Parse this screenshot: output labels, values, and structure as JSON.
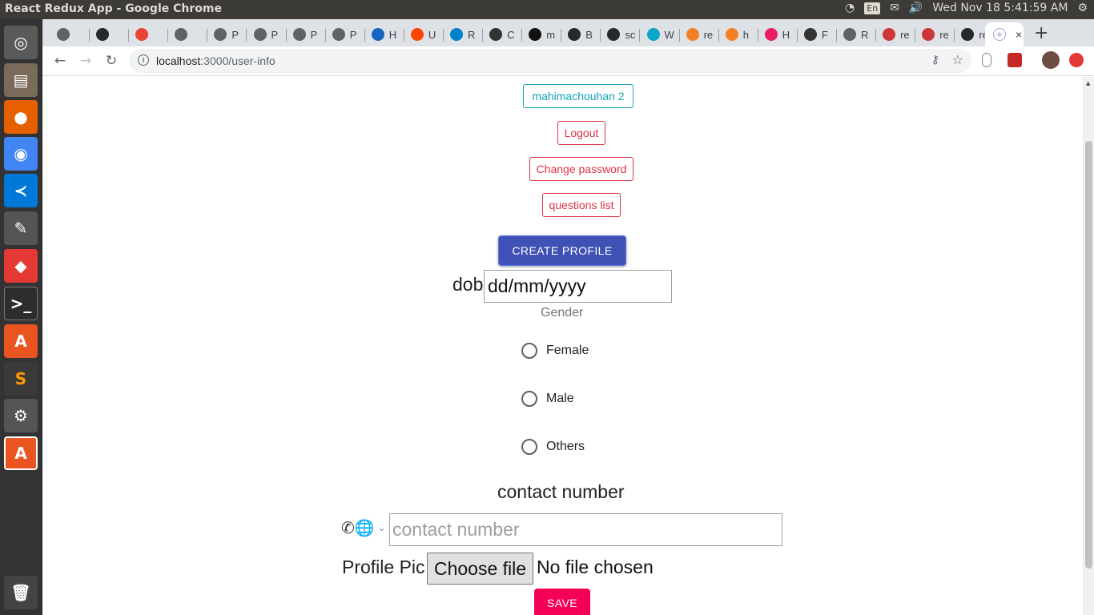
{
  "system": {
    "window_title": "React Redux App - Google Chrome",
    "keyboard": "En",
    "clock": "Wed Nov 18  5:41:59 AM"
  },
  "launcher": {
    "apps": [
      {
        "icon": "ubuntu-dash-icon",
        "color": "#5a5a5a"
      },
      {
        "icon": "files-icon",
        "color": "#7a6a5a"
      },
      {
        "icon": "firefox-icon",
        "color": "#e66000"
      },
      {
        "icon": "chrome-icon",
        "color": "#4285f4"
      },
      {
        "icon": "vscode-icon",
        "color": "#0078d7"
      },
      {
        "icon": "text-editor-icon",
        "color": "#555555"
      },
      {
        "icon": "git-client-icon",
        "color": "#e53935"
      },
      {
        "icon": "terminal-icon",
        "color": "#2d2d2d"
      },
      {
        "icon": "software-center-icon",
        "color": "#e95420"
      },
      {
        "icon": "sublime-text-icon",
        "color": "#3a3a3a"
      },
      {
        "icon": "settings-icon",
        "color": "#555555"
      },
      {
        "icon": "software-updater-icon",
        "color": "#e95420"
      }
    ],
    "trash_icon": "trash-icon"
  },
  "browser": {
    "tabs": [
      {
        "label": "",
        "color": "#5f6368",
        "icon": "globe-icon"
      },
      {
        "label": "",
        "color": "#24292e",
        "icon": "github-icon"
      },
      {
        "label": "",
        "color": "#ea4335",
        "icon": "gmail-icon"
      },
      {
        "label": "",
        "color": "#5f6368",
        "icon": "globe-icon"
      },
      {
        "label": "P",
        "color": "#5f6368",
        "icon": "globe-icon"
      },
      {
        "label": "P",
        "color": "#5f6368",
        "icon": "globe-icon"
      },
      {
        "label": "P",
        "color": "#5f6368",
        "icon": "globe-icon"
      },
      {
        "label": "P",
        "color": "#5f6368",
        "icon": "globe-icon"
      },
      {
        "label": "H",
        "color": "#1565c0",
        "icon": "monitor-icon"
      },
      {
        "label": "U",
        "color": "#ff4500",
        "icon": "reddit-icon"
      },
      {
        "label": "R",
        "color": "#0081cb",
        "icon": "mui-icon"
      },
      {
        "label": "C",
        "color": "#333333",
        "icon": "cube-icon"
      },
      {
        "label": "m",
        "color": "#111111",
        "icon": "medium-icon"
      },
      {
        "label": "B",
        "color": "#24292e",
        "icon": "github-icon"
      },
      {
        "label": "sc",
        "color": "#24292e",
        "icon": "github-icon"
      },
      {
        "label": "W",
        "color": "#0aa5c8",
        "icon": "codepen-icon"
      },
      {
        "label": "re",
        "color": "#f48024",
        "icon": "stackoverflow-icon"
      },
      {
        "label": "h",
        "color": "#f48024",
        "icon": "stackoverflow-icon"
      },
      {
        "label": "H",
        "color": "#e91e63",
        "icon": "play-icon"
      },
      {
        "label": "F",
        "color": "#333333",
        "icon": "linux-icon"
      },
      {
        "label": "R",
        "color": "#5f6368",
        "icon": "globe-icon"
      },
      {
        "label": "re",
        "color": "#cb3837",
        "icon": "npm-icon"
      },
      {
        "label": "re",
        "color": "#cb3837",
        "icon": "npm-icon"
      },
      {
        "label": "re",
        "color": "#24292e",
        "icon": "github-icon"
      }
    ],
    "active_tab_close": "×",
    "new_tab": "+",
    "url_host": "localhost",
    "url_rest": ":3000/user-info"
  },
  "page": {
    "username_button": "mahimachouhan 2",
    "logout_button": "Logout",
    "change_password_button": "Change password",
    "questions_list_button": "questions list",
    "create_profile_button": "CREATE PROFILE",
    "dob_label": "dob",
    "dob_placeholder": "dd/mm/yyyy",
    "gender_label": "Gender",
    "gender_options": [
      "Female",
      "Male",
      "Others"
    ],
    "contact_title": "contact number",
    "contact_placeholder": "contact number",
    "profile_pic_label": "Profile Pic",
    "choose_file_button": "Choose file",
    "no_file_text": "No file chosen",
    "save_button": "SAVE"
  },
  "colors": {
    "info": "#17a2b8",
    "danger": "#dc3545",
    "primary": "#3f51b5",
    "secondary": "#f50057"
  }
}
